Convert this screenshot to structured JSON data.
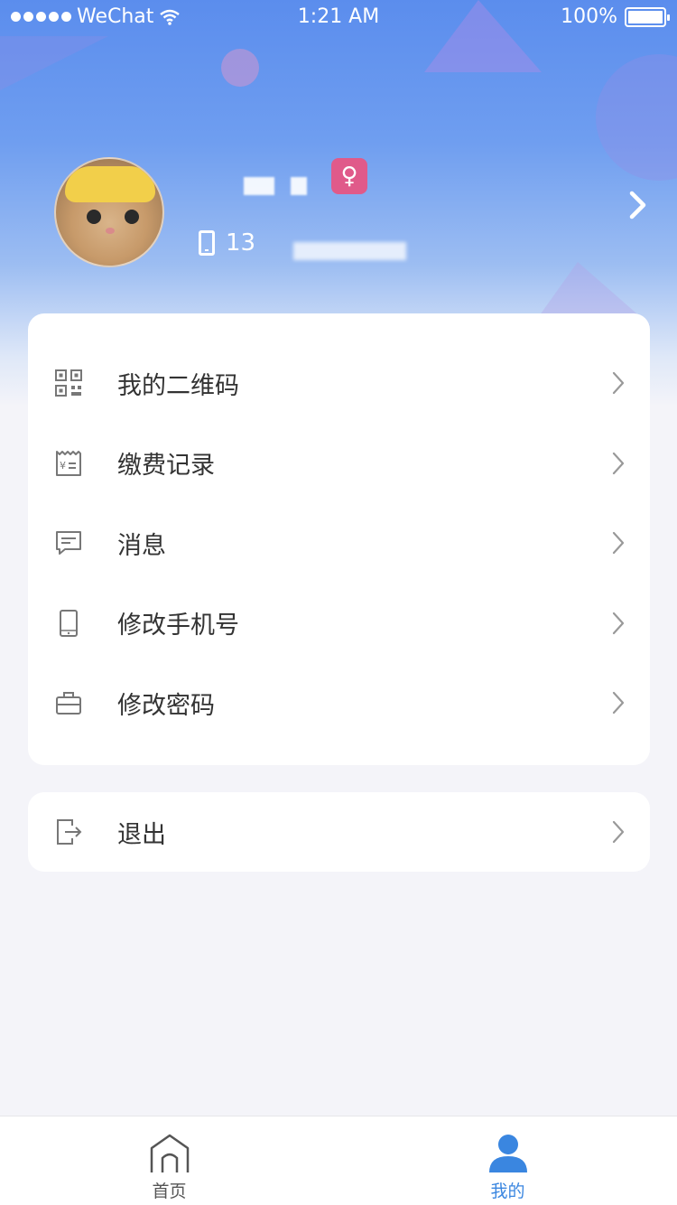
{
  "status_bar": {
    "carrier": "WeChat",
    "time": "1:21 AM",
    "battery": "100%",
    "battery_level": 1.0
  },
  "profile": {
    "phone_prefix": "13",
    "gender_symbol": "♀",
    "gender_badge_color": "#e05a8a"
  },
  "menu": {
    "items": [
      {
        "label": "我的二维码",
        "icon": "qr-code-icon"
      },
      {
        "label": "缴费记录",
        "icon": "receipt-icon"
      },
      {
        "label": "消息",
        "icon": "message-icon"
      },
      {
        "label": "修改手机号",
        "icon": "mobile-phone-icon"
      },
      {
        "label": "修改密码",
        "icon": "lock-icon"
      }
    ]
  },
  "logout": {
    "label": "退出",
    "icon": "logout-icon"
  },
  "tab_bar": {
    "tabs": [
      {
        "label": "首页",
        "icon": "home-icon",
        "active": false
      },
      {
        "label": "我的",
        "icon": "user-icon",
        "active": true
      }
    ],
    "active_color": "#3a86e0"
  }
}
